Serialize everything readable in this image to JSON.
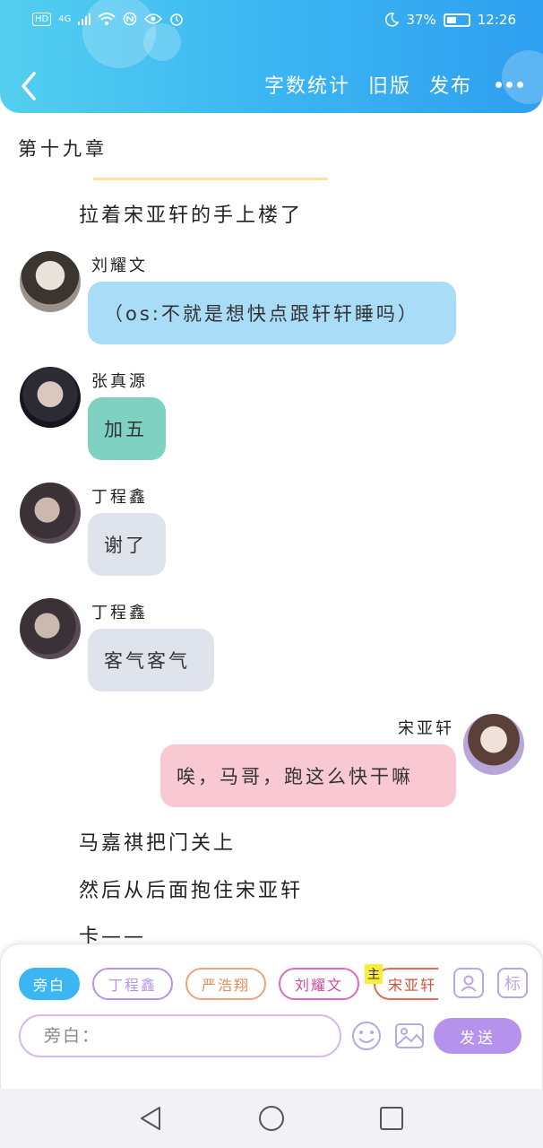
{
  "status_bar": {
    "network": "HD",
    "signal": "4G",
    "battery_percent": "37%",
    "time": "12:26",
    "accent": "#ffffff"
  },
  "header": {
    "background_colors": [
      "#54cff0",
      "#2f9ff0"
    ],
    "actions": {
      "word_count": "字数统计",
      "old_version": "旧版",
      "publish": "发布"
    }
  },
  "story": {
    "chapter_title": "第十九章",
    "opening_narration": "拉着宋亚轩的手上楼了",
    "messages": [
      {
        "speaker": "刘耀文",
        "text": "（os:不就是想快点跟轩轩睡吗）",
        "bubble_color": "#a8dcf7"
      },
      {
        "speaker": "张真源",
        "text": "加五",
        "bubble_color": "#7fd1c2"
      },
      {
        "speaker": "丁程鑫",
        "text": "谢了",
        "bubble_color": "#dfe3ec"
      },
      {
        "speaker": "丁程鑫",
        "text": "客气客气",
        "bubble_color": "#dfe3ec"
      },
      {
        "speaker": "宋亚轩",
        "text": "唉，马哥，跑这么快干嘛",
        "bubble_color": "#f8c9d3"
      }
    ],
    "narrations": [
      "马嘉祺把门关上",
      "然后从后面抱住宋亚轩",
      "卡——"
    ]
  },
  "composer": {
    "roles": [
      {
        "label": "旁白",
        "color": "#3bb6f2",
        "selected": true
      },
      {
        "label": "丁程鑫",
        "color": "#b593ec",
        "selected": false
      },
      {
        "label": "严浩翔",
        "color": "#f0a27a",
        "selected": false
      },
      {
        "label": "刘耀文",
        "color": "#e06ab4",
        "selected": false
      },
      {
        "label": "宋亚轩",
        "color": "#e26a50",
        "selected": false,
        "badge": "主"
      }
    ],
    "role_tool_label": "标",
    "input_placeholder": "旁白：",
    "send_label": "发送",
    "send_color": "#b593ec"
  }
}
